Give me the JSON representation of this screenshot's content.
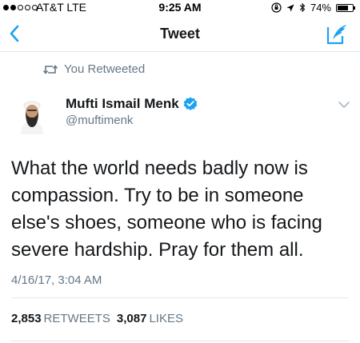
{
  "status_bar": {
    "signal_bars_filled": 2,
    "signal_bars_total": 5,
    "carrier": "AT&T  LTE",
    "time": "9:25 AM",
    "battery_percent": "74%",
    "battery_level": 0.74
  },
  "nav": {
    "title": "Tweet",
    "back_icon": "chevron-left-icon",
    "compose_icon": "compose-tweet-icon"
  },
  "retweet_context": {
    "icon": "retweet-icon",
    "text": "You Retweeted"
  },
  "author": {
    "name": "Mufti Ismail Menk",
    "handle": "@muftimenk",
    "verified": true
  },
  "tweet": {
    "text": "What the world needs badly now is compassion. Try to be in someone else's shoes, someone who is facing severe hardship. Pray for them all.",
    "timestamp": "4/16/17, 3:04 AM"
  },
  "stats": {
    "retweets_count": "2,853",
    "retweets_label": "RETWEETS",
    "likes_count": "3,087",
    "likes_label": "LIKES"
  },
  "colors": {
    "accent": "#1da1f2",
    "secondary_text": "#657786",
    "divider": "#e1e8ed"
  }
}
